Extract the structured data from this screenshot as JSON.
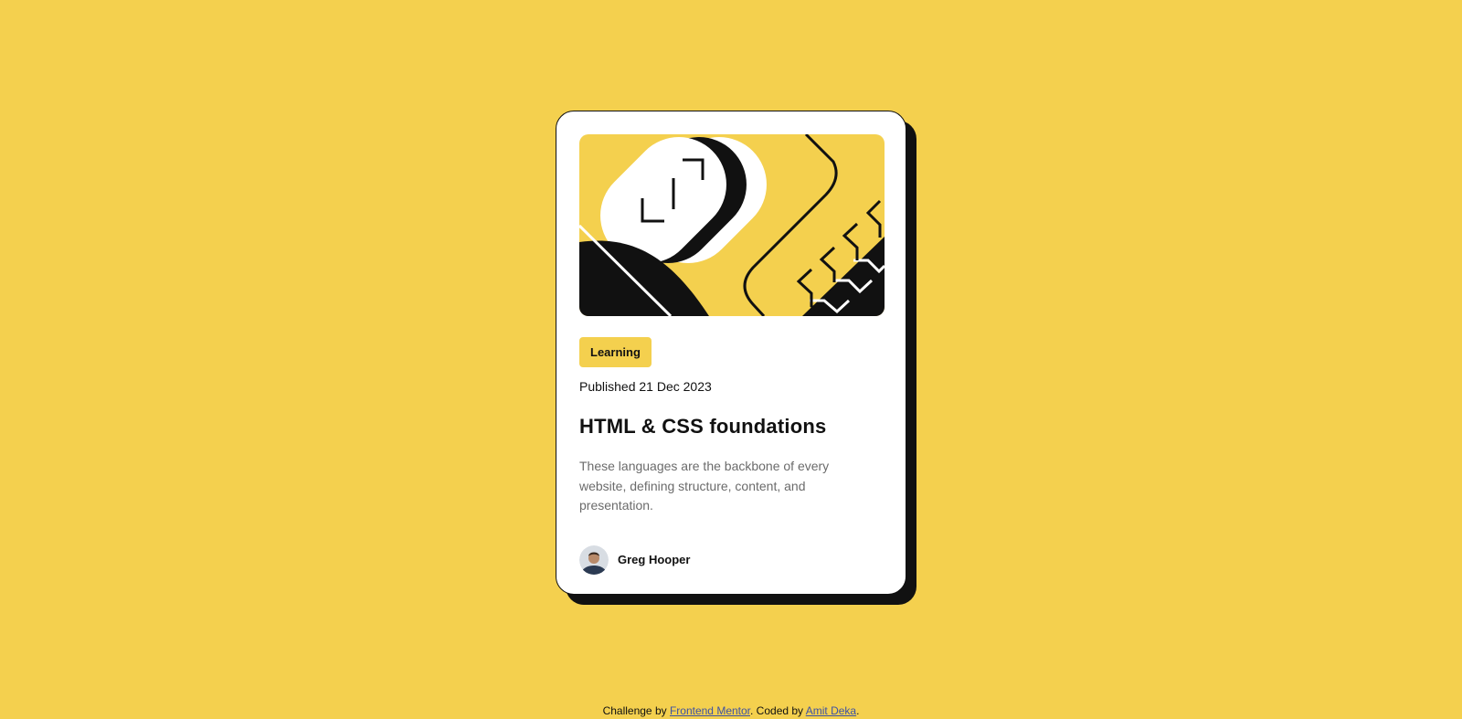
{
  "card": {
    "category": "Learning",
    "published": "Published 21 Dec 2023",
    "title": "HTML & CSS foundations",
    "description": "These languages are the backbone of every website, defining structure, content, and presentation.",
    "author": "Greg Hooper"
  },
  "attribution": {
    "prefix": "Challenge by ",
    "link1": "Frontend Mentor",
    "middle": ". Coded by ",
    "link2": "Amit Deka",
    "suffix": "."
  },
  "colors": {
    "background": "#f4d04e",
    "card": "#ffffff",
    "ink": "#111111",
    "muted": "#6b6b6b",
    "link": "#3e52a3"
  },
  "icons": {
    "hero": "code-illustration",
    "avatar": "avatar-photo"
  }
}
